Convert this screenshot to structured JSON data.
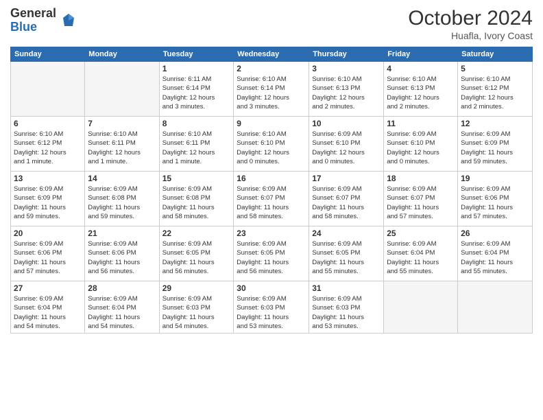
{
  "logo": {
    "general": "General",
    "blue": "Blue"
  },
  "title": {
    "month_year": "October 2024",
    "location": "Huafla, Ivory Coast"
  },
  "headers": [
    "Sunday",
    "Monday",
    "Tuesday",
    "Wednesday",
    "Thursday",
    "Friday",
    "Saturday"
  ],
  "weeks": [
    [
      {
        "day": "",
        "info": ""
      },
      {
        "day": "",
        "info": ""
      },
      {
        "day": "1",
        "info": "Sunrise: 6:11 AM\nSunset: 6:14 PM\nDaylight: 12 hours\nand 3 minutes."
      },
      {
        "day": "2",
        "info": "Sunrise: 6:10 AM\nSunset: 6:14 PM\nDaylight: 12 hours\nand 3 minutes."
      },
      {
        "day": "3",
        "info": "Sunrise: 6:10 AM\nSunset: 6:13 PM\nDaylight: 12 hours\nand 2 minutes."
      },
      {
        "day": "4",
        "info": "Sunrise: 6:10 AM\nSunset: 6:13 PM\nDaylight: 12 hours\nand 2 minutes."
      },
      {
        "day": "5",
        "info": "Sunrise: 6:10 AM\nSunset: 6:12 PM\nDaylight: 12 hours\nand 2 minutes."
      }
    ],
    [
      {
        "day": "6",
        "info": "Sunrise: 6:10 AM\nSunset: 6:12 PM\nDaylight: 12 hours\nand 1 minute."
      },
      {
        "day": "7",
        "info": "Sunrise: 6:10 AM\nSunset: 6:11 PM\nDaylight: 12 hours\nand 1 minute."
      },
      {
        "day": "8",
        "info": "Sunrise: 6:10 AM\nSunset: 6:11 PM\nDaylight: 12 hours\nand 1 minute."
      },
      {
        "day": "9",
        "info": "Sunrise: 6:10 AM\nSunset: 6:10 PM\nDaylight: 12 hours\nand 0 minutes."
      },
      {
        "day": "10",
        "info": "Sunrise: 6:09 AM\nSunset: 6:10 PM\nDaylight: 12 hours\nand 0 minutes."
      },
      {
        "day": "11",
        "info": "Sunrise: 6:09 AM\nSunset: 6:10 PM\nDaylight: 12 hours\nand 0 minutes."
      },
      {
        "day": "12",
        "info": "Sunrise: 6:09 AM\nSunset: 6:09 PM\nDaylight: 11 hours\nand 59 minutes."
      }
    ],
    [
      {
        "day": "13",
        "info": "Sunrise: 6:09 AM\nSunset: 6:09 PM\nDaylight: 11 hours\nand 59 minutes."
      },
      {
        "day": "14",
        "info": "Sunrise: 6:09 AM\nSunset: 6:08 PM\nDaylight: 11 hours\nand 59 minutes."
      },
      {
        "day": "15",
        "info": "Sunrise: 6:09 AM\nSunset: 6:08 PM\nDaylight: 11 hours\nand 58 minutes."
      },
      {
        "day": "16",
        "info": "Sunrise: 6:09 AM\nSunset: 6:07 PM\nDaylight: 11 hours\nand 58 minutes."
      },
      {
        "day": "17",
        "info": "Sunrise: 6:09 AM\nSunset: 6:07 PM\nDaylight: 11 hours\nand 58 minutes."
      },
      {
        "day": "18",
        "info": "Sunrise: 6:09 AM\nSunset: 6:07 PM\nDaylight: 11 hours\nand 57 minutes."
      },
      {
        "day": "19",
        "info": "Sunrise: 6:09 AM\nSunset: 6:06 PM\nDaylight: 11 hours\nand 57 minutes."
      }
    ],
    [
      {
        "day": "20",
        "info": "Sunrise: 6:09 AM\nSunset: 6:06 PM\nDaylight: 11 hours\nand 57 minutes."
      },
      {
        "day": "21",
        "info": "Sunrise: 6:09 AM\nSunset: 6:06 PM\nDaylight: 11 hours\nand 56 minutes."
      },
      {
        "day": "22",
        "info": "Sunrise: 6:09 AM\nSunset: 6:05 PM\nDaylight: 11 hours\nand 56 minutes."
      },
      {
        "day": "23",
        "info": "Sunrise: 6:09 AM\nSunset: 6:05 PM\nDaylight: 11 hours\nand 56 minutes."
      },
      {
        "day": "24",
        "info": "Sunrise: 6:09 AM\nSunset: 6:05 PM\nDaylight: 11 hours\nand 55 minutes."
      },
      {
        "day": "25",
        "info": "Sunrise: 6:09 AM\nSunset: 6:04 PM\nDaylight: 11 hours\nand 55 minutes."
      },
      {
        "day": "26",
        "info": "Sunrise: 6:09 AM\nSunset: 6:04 PM\nDaylight: 11 hours\nand 55 minutes."
      }
    ],
    [
      {
        "day": "27",
        "info": "Sunrise: 6:09 AM\nSunset: 6:04 PM\nDaylight: 11 hours\nand 54 minutes."
      },
      {
        "day": "28",
        "info": "Sunrise: 6:09 AM\nSunset: 6:04 PM\nDaylight: 11 hours\nand 54 minutes."
      },
      {
        "day": "29",
        "info": "Sunrise: 6:09 AM\nSunset: 6:03 PM\nDaylight: 11 hours\nand 54 minutes."
      },
      {
        "day": "30",
        "info": "Sunrise: 6:09 AM\nSunset: 6:03 PM\nDaylight: 11 hours\nand 53 minutes."
      },
      {
        "day": "31",
        "info": "Sunrise: 6:09 AM\nSunset: 6:03 PM\nDaylight: 11 hours\nand 53 minutes."
      },
      {
        "day": "",
        "info": ""
      },
      {
        "day": "",
        "info": ""
      }
    ]
  ]
}
